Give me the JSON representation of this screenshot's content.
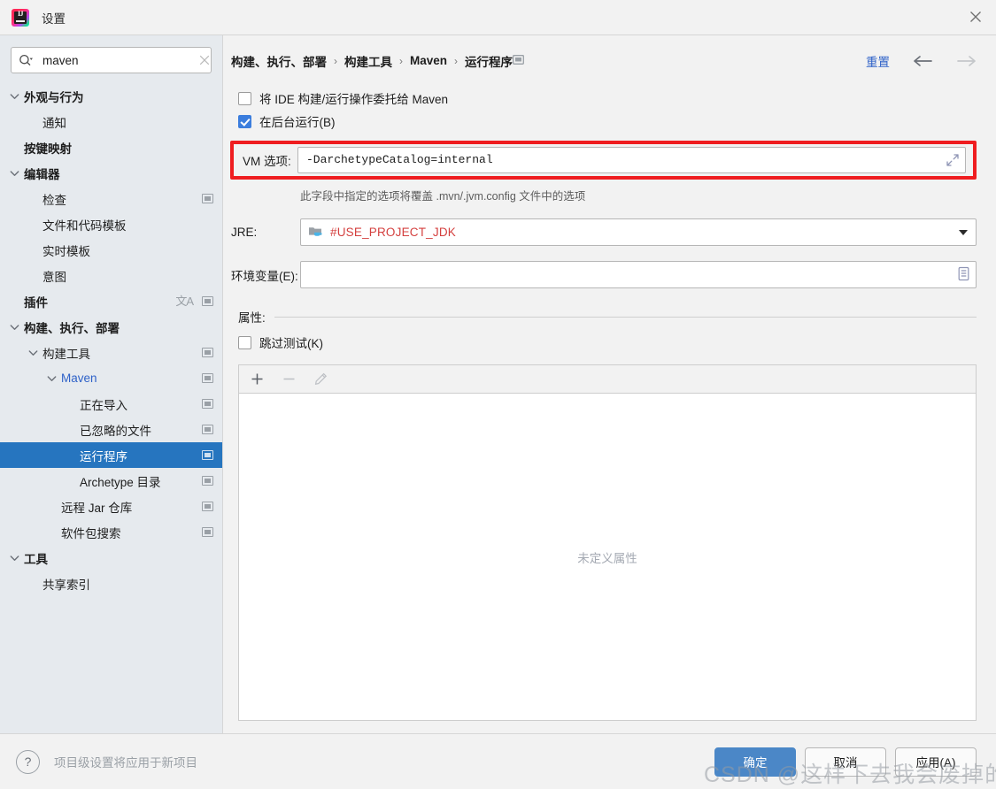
{
  "window": {
    "title": "设置",
    "app_icon": "intellij-idea-icon",
    "close_icon": "close-icon"
  },
  "search": {
    "value": "maven",
    "placeholder": "",
    "icon": "search-icon",
    "clear_icon": "clear-icon"
  },
  "sidebar": {
    "items": [
      {
        "label": "外观与行为",
        "depth": 0,
        "bold": true,
        "chevron": "chevron-down",
        "selected": false,
        "blue": false,
        "project_icon": false,
        "translate_icon": false
      },
      {
        "label": "通知",
        "depth": 1,
        "bold": false,
        "chevron": "none",
        "selected": false,
        "blue": false,
        "project_icon": false,
        "translate_icon": false
      },
      {
        "label": "按键映射",
        "depth": 0,
        "bold": true,
        "chevron": "none",
        "selected": false,
        "blue": false,
        "project_icon": false,
        "translate_icon": false
      },
      {
        "label": "编辑器",
        "depth": 0,
        "bold": true,
        "chevron": "chevron-down",
        "selected": false,
        "blue": false,
        "project_icon": false,
        "translate_icon": false
      },
      {
        "label": "检查",
        "depth": 1,
        "bold": false,
        "chevron": "none",
        "selected": false,
        "blue": false,
        "project_icon": true,
        "translate_icon": false
      },
      {
        "label": "文件和代码模板",
        "depth": 1,
        "bold": false,
        "chevron": "none",
        "selected": false,
        "blue": false,
        "project_icon": false,
        "translate_icon": false
      },
      {
        "label": "实时模板",
        "depth": 1,
        "bold": false,
        "chevron": "none",
        "selected": false,
        "blue": false,
        "project_icon": false,
        "translate_icon": false
      },
      {
        "label": "意图",
        "depth": 1,
        "bold": false,
        "chevron": "none",
        "selected": false,
        "blue": false,
        "project_icon": false,
        "translate_icon": false
      },
      {
        "label": "插件",
        "depth": 0,
        "bold": true,
        "chevron": "none",
        "selected": false,
        "blue": false,
        "project_icon": true,
        "translate_icon": true
      },
      {
        "label": "构建、执行、部署",
        "depth": 0,
        "bold": true,
        "chevron": "chevron-down",
        "selected": false,
        "blue": false,
        "project_icon": false,
        "translate_icon": false
      },
      {
        "label": "构建工具",
        "depth": 1,
        "bold": false,
        "chevron": "chevron-down",
        "selected": false,
        "blue": false,
        "project_icon": true,
        "translate_icon": false
      },
      {
        "label": "Maven",
        "depth": 2,
        "bold": false,
        "chevron": "chevron-down",
        "selected": false,
        "blue": true,
        "project_icon": true,
        "translate_icon": false
      },
      {
        "label": "正在导入",
        "depth": 3,
        "bold": false,
        "chevron": "none",
        "selected": false,
        "blue": false,
        "project_icon": true,
        "translate_icon": false
      },
      {
        "label": "已忽略的文件",
        "depth": 3,
        "bold": false,
        "chevron": "none",
        "selected": false,
        "blue": false,
        "project_icon": true,
        "translate_icon": false
      },
      {
        "label": "运行程序",
        "depth": 3,
        "bold": false,
        "chevron": "none",
        "selected": true,
        "blue": false,
        "project_icon": true,
        "translate_icon": false
      },
      {
        "label": "Archetype 目录",
        "depth": 3,
        "bold": false,
        "chevron": "none",
        "selected": false,
        "blue": false,
        "project_icon": true,
        "translate_icon": false
      },
      {
        "label": "远程 Jar 仓库",
        "depth": 2,
        "bold": false,
        "chevron": "none",
        "selected": false,
        "blue": false,
        "project_icon": true,
        "translate_icon": false
      },
      {
        "label": "软件包搜索",
        "depth": 2,
        "bold": false,
        "chevron": "none",
        "selected": false,
        "blue": false,
        "project_icon": true,
        "translate_icon": false
      },
      {
        "label": "工具",
        "depth": 0,
        "bold": true,
        "chevron": "chevron-down",
        "selected": false,
        "blue": false,
        "project_icon": false,
        "translate_icon": false
      },
      {
        "label": "共享索引",
        "depth": 1,
        "bold": false,
        "chevron": "none",
        "selected": false,
        "blue": false,
        "project_icon": false,
        "translate_icon": false
      }
    ]
  },
  "breadcrumb": {
    "parts": [
      "构建、执行、部署",
      "构建工具",
      "Maven",
      "运行程序"
    ],
    "separator": "›",
    "trailing_icon": "project-scope-icon",
    "reset_label": "重置",
    "back_icon": "arrow-left-icon",
    "forward_icon": "arrow-right-icon"
  },
  "form": {
    "delegate_checkbox": {
      "label": "将 IDE 构建/运行操作委托给 Maven",
      "checked": false
    },
    "background_checkbox": {
      "label": "在后台运行(B)",
      "checked": true
    },
    "vm_options": {
      "label": "VM 选项:",
      "value": "-DarchetypeCatalog=internal",
      "placeholder": "",
      "expand_icon": "expand-icon",
      "highlight_color": "#ef1d20"
    },
    "vm_hint": "此字段中指定的选项将覆盖 .mvn/.jvm.config 文件中的选项",
    "jre": {
      "label": "JRE:",
      "value": "#USE_PROJECT_JDK",
      "value_color": "#d4403f",
      "folder_icon": "folder-jdk-icon",
      "caret_icon": "chevron-down-icon"
    },
    "env": {
      "label": "环境变量(E):",
      "value": "",
      "placeholder": "",
      "browse_icon": "list-edit-icon"
    },
    "properties_section": {
      "label": "属性:",
      "skip_tests_checkbox": {
        "label": "跳过测试(K)",
        "checked": false
      },
      "toolbar": [
        {
          "name": "add-button",
          "glyph": "+",
          "enabled": true
        },
        {
          "name": "remove-button",
          "glyph": "−",
          "enabled": false
        },
        {
          "name": "edit-button",
          "glyph": "pencil",
          "enabled": false
        }
      ],
      "empty_text": "未定义属性"
    }
  },
  "footer": {
    "help_icon": "help-icon",
    "note": "项目级设置将应用于新项目",
    "buttons": [
      {
        "label": "确定",
        "primary": true,
        "name": "ok-button"
      },
      {
        "label": "取消",
        "primary": false,
        "name": "cancel-button"
      },
      {
        "label": "应用(A)",
        "primary": false,
        "name": "apply-button"
      }
    ]
  },
  "watermark": {
    "text": "CSDN @这样下去我会废掉的"
  }
}
